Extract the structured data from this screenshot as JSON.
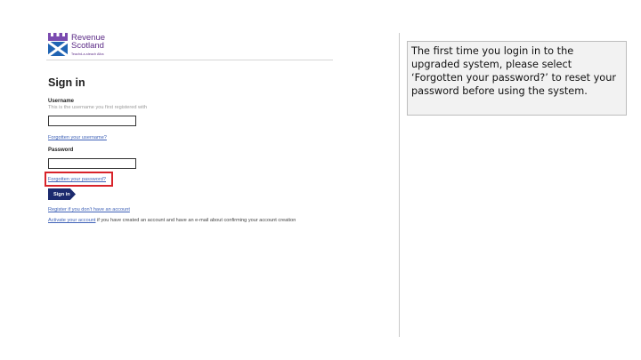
{
  "logo": {
    "line1": "Revenue",
    "line2": "Scotland",
    "tagline": "Teachd-a-steach Alba"
  },
  "form": {
    "title": "Sign in",
    "username_label": "Username",
    "username_hint": "This is the username you first registered with",
    "username_value": "",
    "forgot_username": "Forgotten your username?",
    "password_label": "Password",
    "password_value": "",
    "forgot_password": "Forgotten your password?",
    "signin_button": "Sign in",
    "register_link": "Register if you don't have an account",
    "activate_link": "Activate your account",
    "activate_text": " if you have created an account and have an e-mail about confirming your account creation"
  },
  "note": {
    "text": "The first time you login in to the upgraded system, please select ‘Forgotten your password?’ to reset your password before using the system."
  },
  "colors": {
    "brand": "#5b2a86",
    "button": "#1c2a6e",
    "link": "#3f62b7",
    "highlight": "#d8232a"
  }
}
